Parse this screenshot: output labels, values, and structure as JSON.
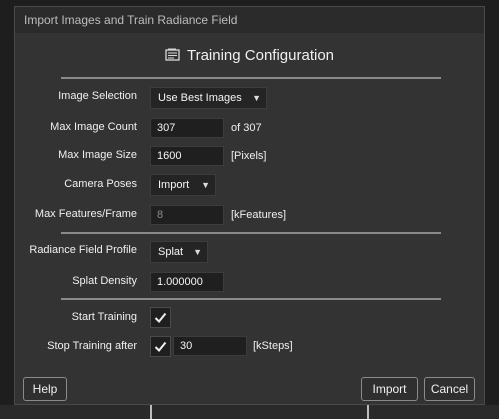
{
  "dialog": {
    "title": "Import Images and Train Radiance Field",
    "heading": "Training Configuration"
  },
  "fields": {
    "image_selection": {
      "label": "Image Selection",
      "value": "Use Best Images"
    },
    "max_image_count": {
      "label": "Max Image Count",
      "value": "307",
      "suffix": "of 307"
    },
    "max_image_size": {
      "label": "Max Image Size",
      "value": "1600",
      "suffix": "[Pixels]"
    },
    "camera_poses": {
      "label": "Camera Poses",
      "value": "Import"
    },
    "max_features": {
      "label": "Max Features/Frame",
      "value": "8",
      "suffix": "[kFeatures]"
    },
    "radiance_profile": {
      "label": "Radiance Field Profile",
      "value": "Splat"
    },
    "splat_density": {
      "label": "Splat Density",
      "value": "1.000000"
    },
    "start_training": {
      "label": "Start Training",
      "checked": true
    },
    "stop_training": {
      "label": "Stop Training after",
      "checked": true,
      "value": "30",
      "suffix": "[kSteps]"
    }
  },
  "buttons": {
    "help": "Help",
    "import": "Import",
    "cancel": "Cancel"
  },
  "icons": {
    "heading": "training-config-icon",
    "dropdown": "chevron-down-icon",
    "check": "checkmark-icon"
  }
}
